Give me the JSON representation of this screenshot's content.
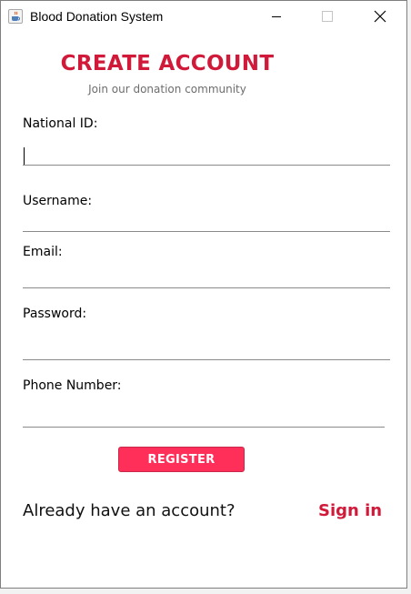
{
  "window": {
    "title": "Blood Donation System"
  },
  "form": {
    "heading": "CREATE ACCOUNT",
    "subheading": "Join our donation community",
    "fields": [
      {
        "label": "National ID:",
        "value": ""
      },
      {
        "label": "Username:",
        "value": ""
      },
      {
        "label": "Email:",
        "value": ""
      },
      {
        "label": "Password:",
        "value": ""
      },
      {
        "label": "Phone Number:",
        "value": ""
      }
    ],
    "register_label": "REGISTER",
    "already_text": "Already have an account?",
    "signin_label": "Sign in"
  },
  "colors": {
    "accent": "#d11a3a",
    "button": "#ff2f5a"
  },
  "icons": {
    "app": "java-cup-icon",
    "minimize": "minimize-icon",
    "maximize": "maximize-icon",
    "close": "close-icon"
  }
}
